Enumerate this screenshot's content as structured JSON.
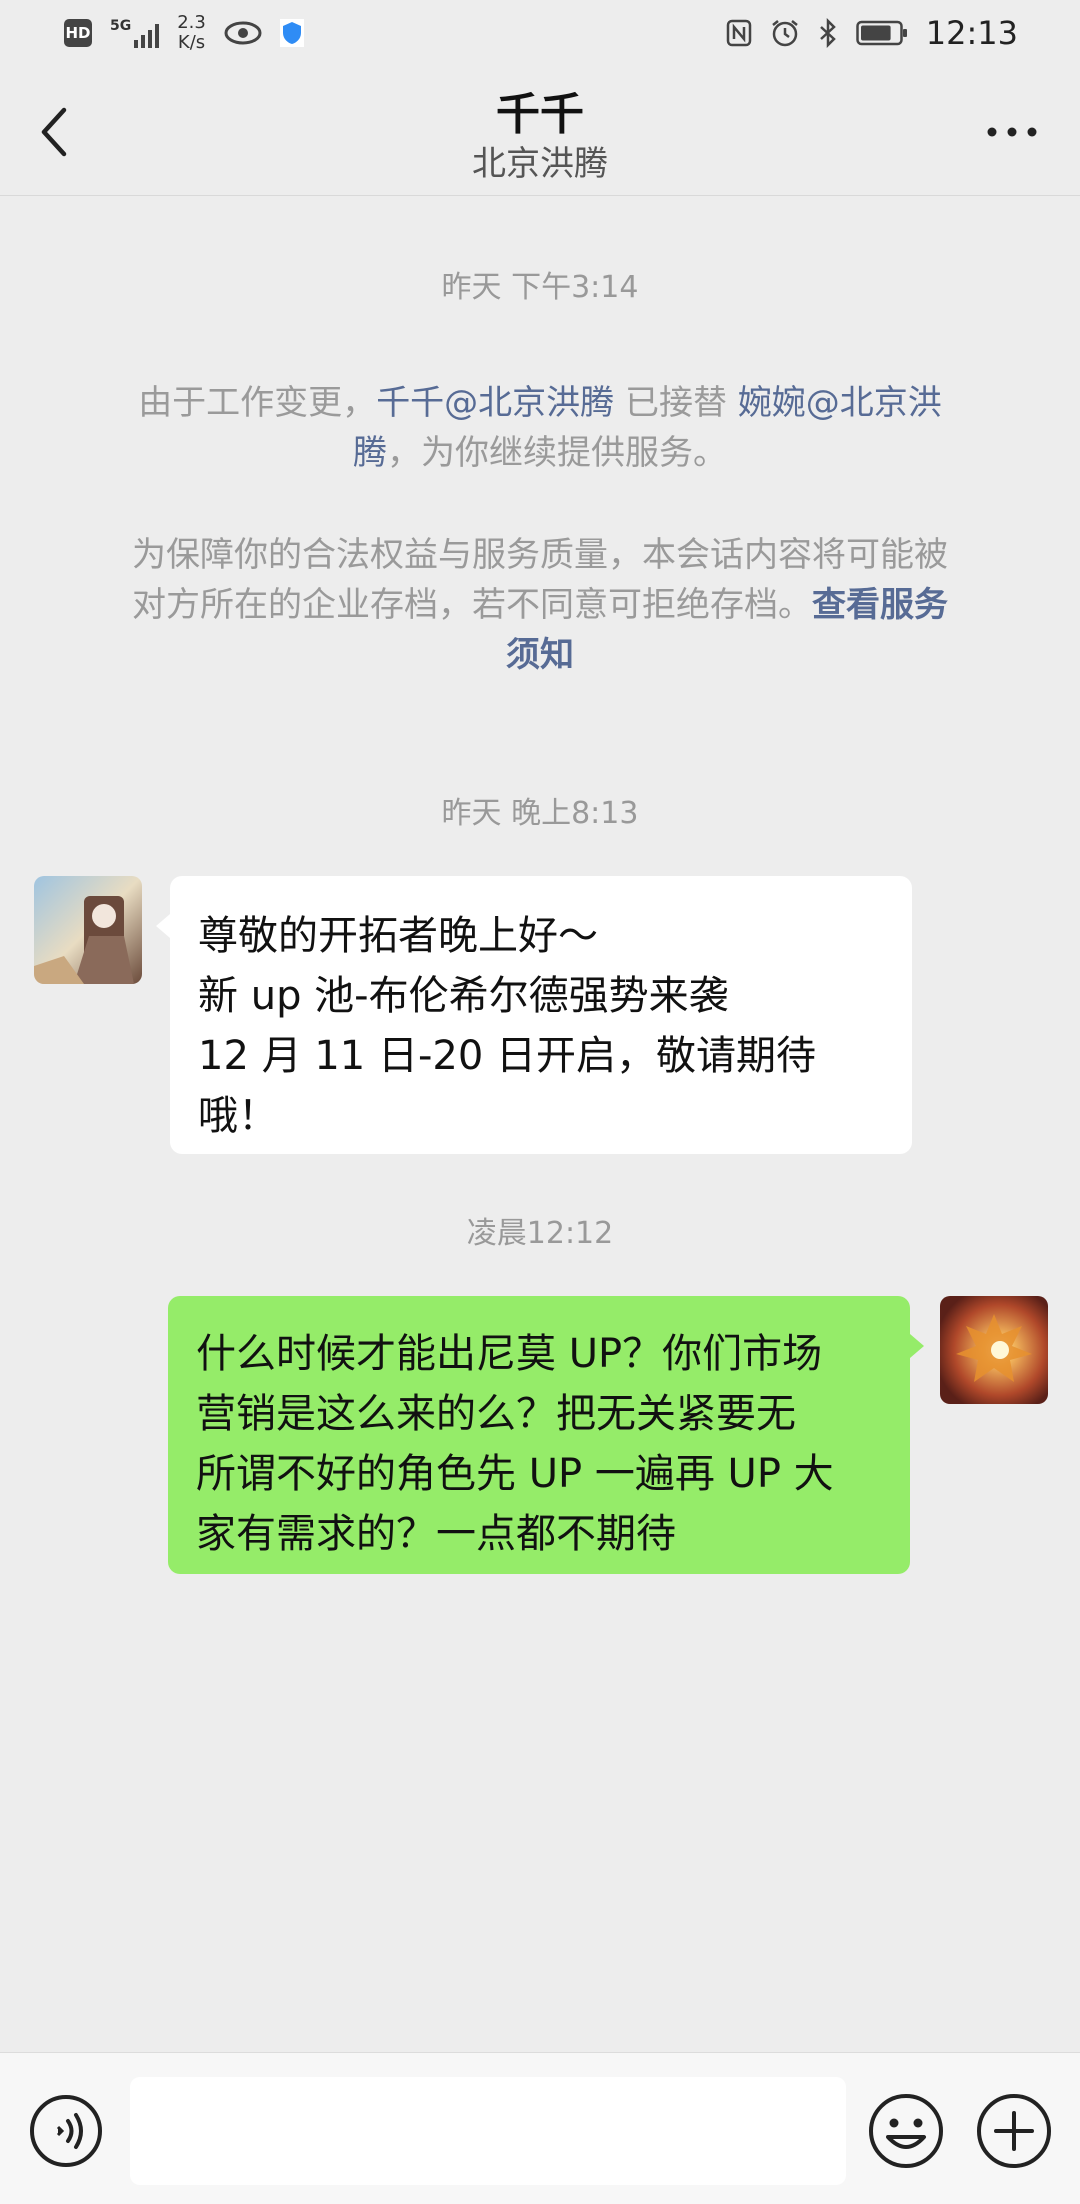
{
  "status_bar": {
    "hd": "HD",
    "network": "5G",
    "speed_value": "2.3",
    "speed_unit": "K/s",
    "time": "12:13",
    "battery_level": 0.8
  },
  "header": {
    "title": "千千",
    "subtitle": "北京洪腾"
  },
  "messages": {
    "timestamp_1": "昨天 下午3:14",
    "notice_1": {
      "line1_prefix": "由于工作变更，",
      "line1_link1": "千千@北京洪腾",
      "line1_mid": " 已接替 ",
      "line1_link2": "婉婉@北京洪",
      "line2_link2_cont": "腾",
      "line2_suffix": "，为你继续提供服务。"
    },
    "notice_2": {
      "line1": "为保障你的合法权益与服务质量，本会话内容将可能被",
      "line2_text": "对方所在的企业存档，若不同意可拒绝存档。",
      "line2_link": "查看服务",
      "line3_link": "须知"
    },
    "timestamp_2": "昨天 晚上8:13",
    "incoming": {
      "line1": "尊敬的开拓者晚上好～",
      "line2": "新 up 池-布伦希尔德强势来袭",
      "line3": "12 月 11 日-20 日开启，敬请期待",
      "line4": "哦！"
    },
    "timestamp_3": "凌晨12:12",
    "outgoing": {
      "line1": "什么时候才能出尼莫 UP？你们市场",
      "line2": "营销是这么来的么？把无关紧要无",
      "line3": "所谓不好的角色先 UP 一遍再 UP 大",
      "line4": "家有需求的？一点都不期待"
    }
  },
  "colors": {
    "background": "#ededed",
    "bubble_outgoing": "#95ec69",
    "bubble_incoming": "#ffffff",
    "link": "#576b95"
  },
  "input_bar": {
    "value": "",
    "icons": [
      "voice-icon",
      "emoji-icon",
      "plus-icon"
    ]
  }
}
